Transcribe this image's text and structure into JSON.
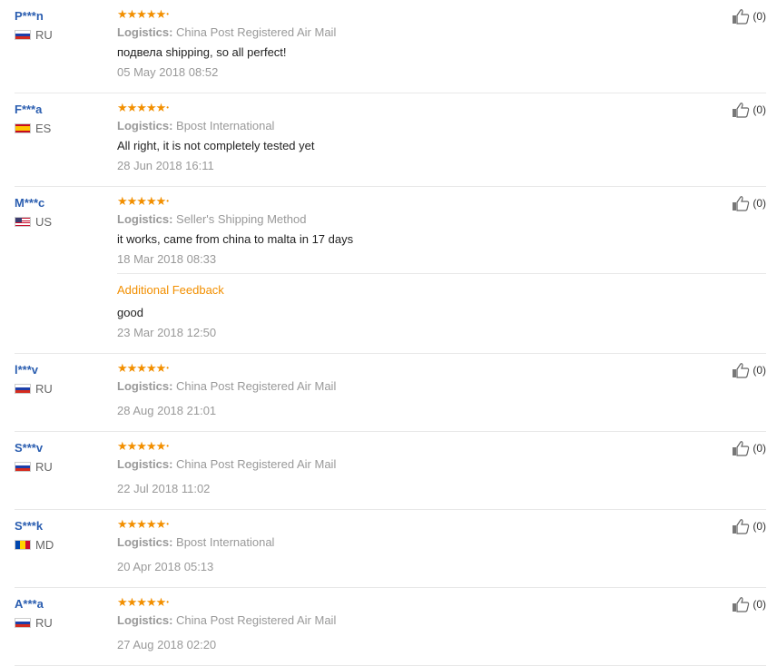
{
  "labels": {
    "logistics": "Logistics:",
    "additional_feedback": "Additional Feedback"
  },
  "reviews": [
    {
      "user": "P***n",
      "country": "RU",
      "logistics": "China Post Registered Air Mail",
      "text": "подвела shipping, so all perfect!",
      "date": "05 May 2018 08:52",
      "likes": "(0)"
    },
    {
      "user": "F***a",
      "country": "ES",
      "logistics": "Bpost International",
      "text": "All right, it is not completely tested yet",
      "date": "28 Jun 2018 16:11",
      "likes": "(0)"
    },
    {
      "user": "M***c",
      "country": "US",
      "logistics": "Seller's Shipping Method",
      "text": "it works, came from china to malta in 17 days",
      "date": "18 Mar 2018 08:33",
      "likes": "(0)",
      "additional": {
        "text": "good",
        "date": "23 Mar 2018 12:50"
      }
    },
    {
      "user": "l***v",
      "country": "RU",
      "logistics": "China Post Registered Air Mail",
      "date": "28 Aug 2018 21:01",
      "likes": "(0)"
    },
    {
      "user": "S***v",
      "country": "RU",
      "logistics": "China Post Registered Air Mail",
      "date": "22 Jul 2018 11:02",
      "likes": "(0)"
    },
    {
      "user": "S***k",
      "country": "MD",
      "logistics": "Bpost International",
      "date": "20 Apr 2018 05:13",
      "likes": "(0)"
    },
    {
      "user": "A***a",
      "country": "RU",
      "logistics": "China Post Registered Air Mail",
      "date": "27 Aug 2018 02:20",
      "likes": "(0)"
    }
  ],
  "rating_stars": "★★★★★",
  "colors": {
    "username": "#2b5eb0",
    "stars": "#f28f00",
    "muted": "#999999",
    "divider": "#e8e8e8"
  },
  "icons": {
    "like": "thumbs-up-icon"
  }
}
